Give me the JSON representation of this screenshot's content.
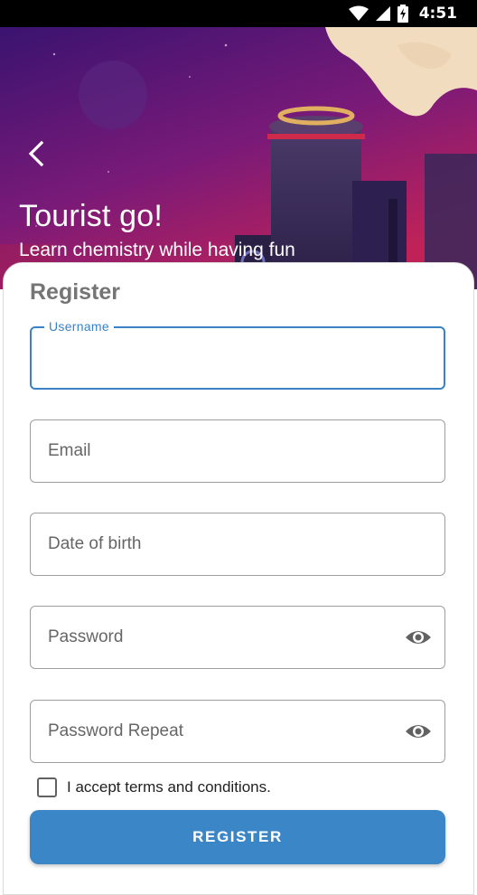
{
  "status_bar": {
    "time": "4:51",
    "icons": [
      "wifi-icon",
      "signal-icon",
      "battery-charging-icon"
    ]
  },
  "header": {
    "title": "Tourist go!",
    "subtitle": "Learn chemistry while having fun",
    "back_icon": "chevron-left-icon"
  },
  "form": {
    "title": "Register",
    "fields": [
      {
        "label": "Username",
        "value": "",
        "focused": true
      },
      {
        "label": "Email",
        "value": ""
      },
      {
        "label": "Date of birth",
        "value": ""
      },
      {
        "label": "Password",
        "value": "",
        "trailing_icon": "eye-icon"
      },
      {
        "label": "Password Repeat",
        "value": "",
        "trailing_icon": "eye-icon"
      }
    ],
    "terms_label": "I accept terms and conditions.",
    "terms_checked": false,
    "submit_label": "REGISTER"
  },
  "colors": {
    "accent": "#3a86c6",
    "focus_border": "#3a82c4",
    "hero_purple": "#5a1a7e",
    "hero_magenta": "#b0205c"
  }
}
